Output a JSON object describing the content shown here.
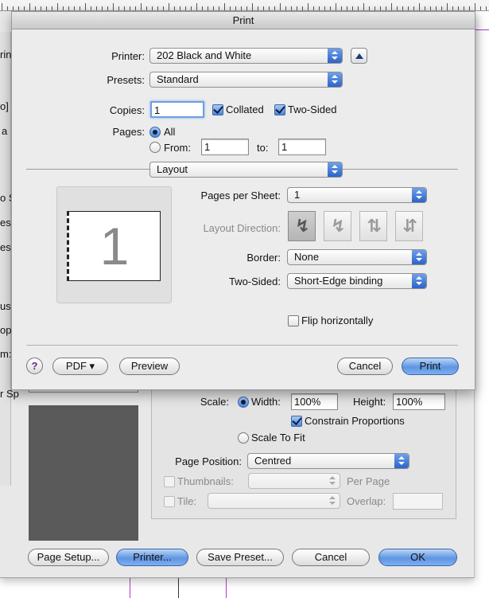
{
  "print_dialog": {
    "title": "Print",
    "printer": {
      "label": "Printer:",
      "value": "202 Black and White"
    },
    "presets": {
      "label": "Presets:",
      "value": "Standard"
    },
    "copies": {
      "label": "Copies:",
      "value": "1",
      "collated": "Collated",
      "two_sided": "Two-Sided"
    },
    "pages": {
      "label": "Pages:",
      "all": "All",
      "from": "From:",
      "from_value": "1",
      "to": "to:",
      "to_value": "1"
    },
    "section": {
      "value": "Layout"
    },
    "preview_number": "1",
    "pages_per_sheet": {
      "label": "Pages per Sheet:",
      "value": "1"
    },
    "layout_direction": {
      "label": "Layout Direction:"
    },
    "border": {
      "label": "Border:",
      "value": "None"
    },
    "two_sided_binding": {
      "label": "Two-Sided:",
      "value": "Short-Edge binding"
    },
    "flip": {
      "label": "Flip horizontally"
    },
    "help": "?",
    "buttons": {
      "pdf": "PDF ▾",
      "preview": "Preview",
      "cancel": "Cancel",
      "print": "Print"
    }
  },
  "back_dialog": {
    "left_fragments": [
      "rin",
      "o]",
      "a",
      "o S",
      "es:",
      "es:",
      "us",
      "op:",
      "m:",
      "r Sp"
    ],
    "scale": {
      "label": "Scale:",
      "width_label": "Width:",
      "width_value": "100%",
      "height_label": "Height:",
      "height_value": "100%"
    },
    "constrain": "Constrain Proportions",
    "scale_to_fit": "Scale To Fit",
    "page_position": {
      "label": "Page Position:",
      "value": "Centred"
    },
    "thumbnails": {
      "label": "Thumbnails:",
      "per_page": "Per Page"
    },
    "tile": {
      "label": "Tile:",
      "overlap": "Overlap:"
    },
    "buttons": {
      "page_setup": "Page Setup...",
      "printer": "Printer...",
      "save_preset": "Save Preset...",
      "cancel": "Cancel",
      "ok": "OK"
    }
  },
  "colors": {
    "accent": "#4d86dc",
    "guide_magenta": "#b03cc8",
    "preview_dark": "#5a5a5a"
  }
}
